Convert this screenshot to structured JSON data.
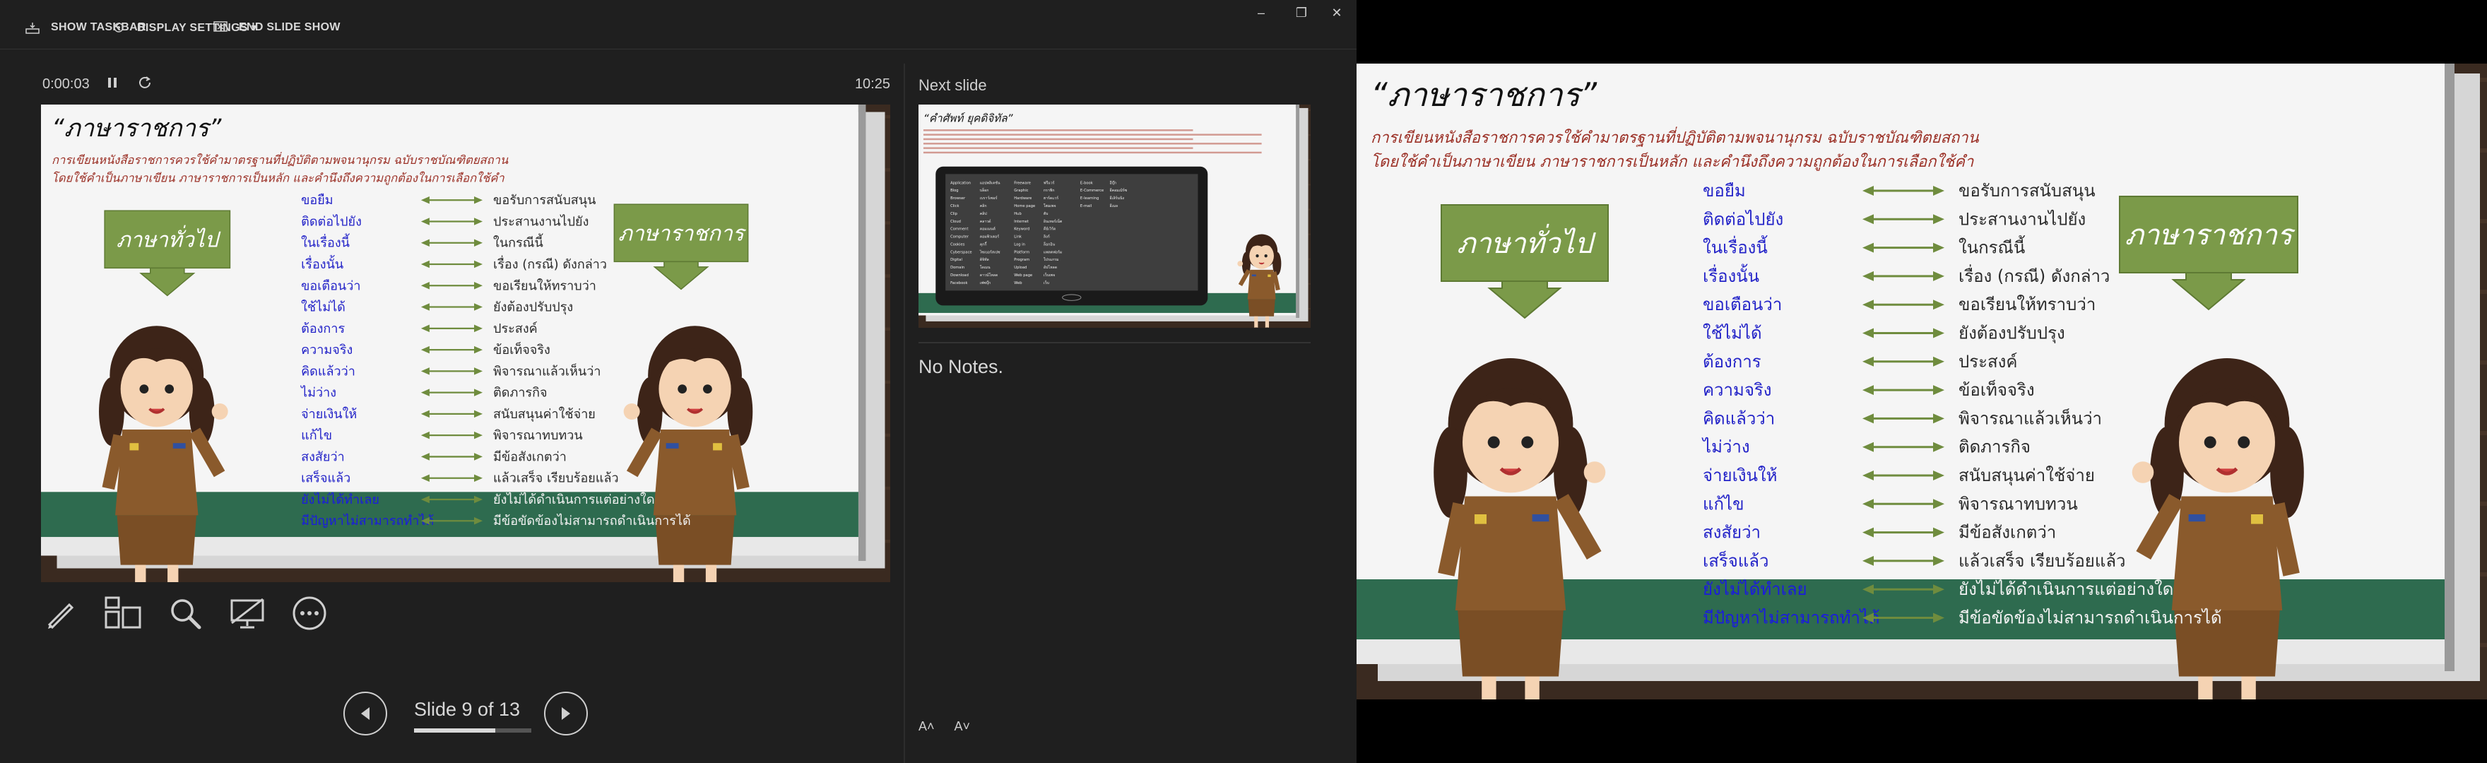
{
  "topbar": {
    "show_taskbar": "SHOW TASKBAR",
    "display_settings": "DISPLAY SETTINGS ▾",
    "end_slide_show": "END SLIDE SHOW"
  },
  "window_controls": {
    "minimize": "–",
    "restore": "❐",
    "close": "✕"
  },
  "timer": {
    "elapsed": "0:00:03",
    "clock": "10:25"
  },
  "navigation": {
    "slide_label": "Slide 9 of 13",
    "current": 9,
    "total": 13
  },
  "next_slide_label": "Next slide",
  "notes_text": "No Notes.",
  "font_controls": {
    "increase": "A˄",
    "decrease": "A˅"
  },
  "slide": {
    "title": "“ภาษาราชการ”",
    "subtitle_line1": "การเขียนหนังสือราชการควรใช้คำมาตรฐานที่ปฏิบัติตามพจนานุกรม ฉบับราชบัณฑิตยสถาน",
    "subtitle_line2": "โดยใช้คำเป็นภาษาเขียน ภาษาราชการเป็นหลัก และคำนึงถึงความถูกต้องในการเลือกใช้คำ",
    "left_box": "ภาษาทั่วไป",
    "right_box": "ภาษาราชการ",
    "pairs": [
      {
        "general": "ขอยืม",
        "official": "ขอรับการสนับสนุน"
      },
      {
        "general": "ติดต่อไปยัง",
        "official": "ประสานงานไปยัง"
      },
      {
        "general": "ในเรื่องนี้",
        "official": "ในกรณีนี้"
      },
      {
        "general": "เรื่องนั้น",
        "official": "เรื่อง (กรณี) ดังกล่าว"
      },
      {
        "general": "ขอเตือนว่า",
        "official": "ขอเรียนให้ทราบว่า"
      },
      {
        "general": "ใช้ไม่ได้",
        "official": "ยังต้องปรับปรุง"
      },
      {
        "general": "ต้องการ",
        "official": "ประสงค์"
      },
      {
        "general": "ความจริง",
        "official": "ข้อเท็จจริง"
      },
      {
        "general": "คิดแล้วว่า",
        "official": "พิจารณาแล้วเห็นว่า"
      },
      {
        "general": "ไม่ว่าง",
        "official": "ติดภารกิจ"
      },
      {
        "general": "จ่ายเงินให้",
        "official": "สนับสนุนค่าใช้จ่าย"
      },
      {
        "general": "แก้ไข",
        "official": "พิจารณาทบทวน"
      },
      {
        "general": "สงสัยว่า",
        "official": "มีข้อสังเกตว่า"
      },
      {
        "general": "เสร็จแล้ว",
        "official": "แล้วเสร็จ เรียบร้อยแล้ว"
      },
      {
        "general": "ยังไม่ได้ทำเลย",
        "official": "ยังไม่ได้ดำเนินการแต่อย่างใด"
      },
      {
        "general": "มีปัญหาไม่สามารถทำได้",
        "official": "มีข้อขัดข้องไม่สามารถดำเนินการได้"
      }
    ]
  },
  "next": {
    "title": "“คำศัพท์ ยุคดิจิทัล”",
    "rows": [
      [
        "Application",
        "แอปพลิเคชัน",
        "Freeware",
        "ฟรีแวร์",
        "E-book",
        "อีบุ๊ก"
      ],
      [
        "Blog",
        "บล็อก",
        "Graphic",
        "กราฟิก",
        "E-Commerce",
        "อีคอมเมิร์ซ"
      ],
      [
        "Browser",
        "เบราว์เซอร์",
        "Hardware",
        "ฮาร์ดแวร์",
        "E-learning",
        "อีเลิร์นนิง"
      ],
      [
        "Click",
        "คลิก",
        "Home page",
        "โฮมเพจ",
        "E-mail",
        "อีเมล"
      ],
      [
        "Clip",
        "คลิป",
        "Hub",
        "ฮับ",
        "",
        ""
      ],
      [
        "Cloud",
        "คลาวด์",
        "Internet",
        "อินเทอร์เน็ต",
        "",
        ""
      ],
      [
        "Comment",
        "คอมเมนต์",
        "Keyword",
        "คีย์เวิร์ด",
        "",
        ""
      ],
      [
        "Computer",
        "คอมพิวเตอร์",
        "Link",
        "ลิงก์",
        "",
        ""
      ],
      [
        "Cookies",
        "คุกกี้",
        "Log in",
        "ล็อกอิน",
        "",
        ""
      ],
      [
        "Cyberspace",
        "ไซเบอร์สเปซ",
        "Platform",
        "แพลตฟอร์ม",
        "",
        ""
      ],
      [
        "Digital",
        "ดิจิทัล",
        "Program",
        "โปรแกรม",
        "",
        ""
      ],
      [
        "Domain",
        "โดเมน",
        "Upload",
        "อัปโหลด",
        "",
        ""
      ],
      [
        "Download",
        "ดาวน์โหลด",
        "Web page",
        "เว็บเพจ",
        "",
        ""
      ],
      [
        "Facebook",
        "เฟซบุ๊ก",
        "Web",
        "เว็บ",
        "",
        ""
      ]
    ]
  },
  "colors": {
    "panel_bg": "#1f1f1f",
    "title_dark": "#111111",
    "subtitle_red": "#9b3026",
    "general_blue": "#2323c8",
    "box_green": "#7b9a49",
    "arrow_green": "#6f8c3e",
    "band_green": "#2e6b4f"
  }
}
